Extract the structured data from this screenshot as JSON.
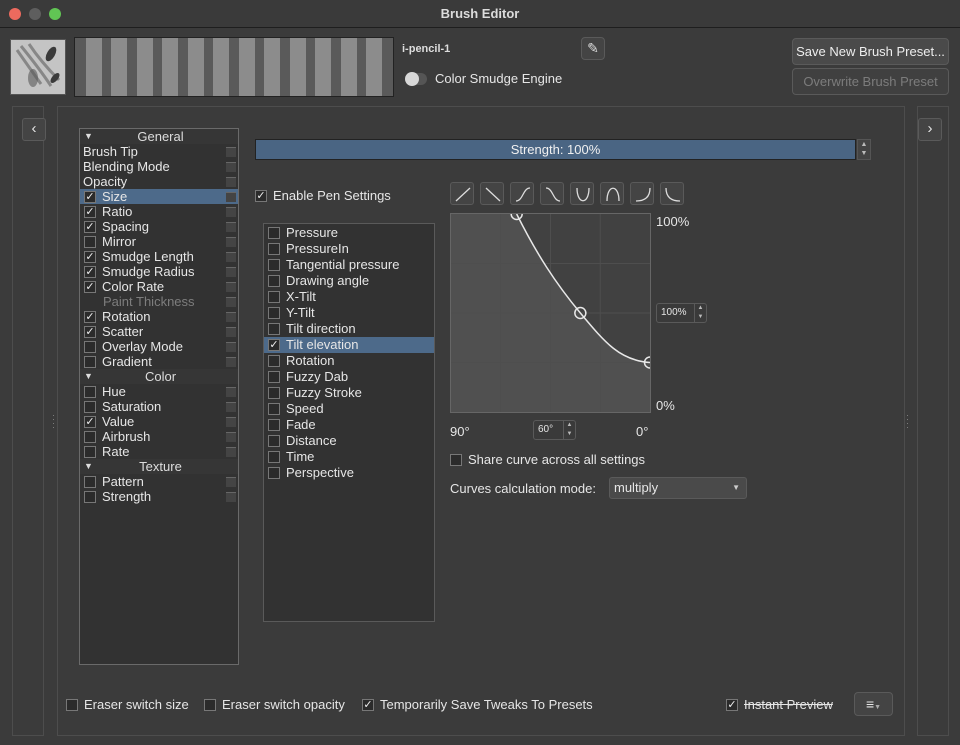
{
  "window": {
    "title": "Brush Editor"
  },
  "header": {
    "preset_name": "i-pencil-1",
    "engine_label": "Color Smudge Engine",
    "save_new_label": "Save New Brush Preset...",
    "overwrite_label": "Overwrite Brush Preset",
    "edit_icon": "pencil-icon"
  },
  "nav": {
    "prev_icon": "chevron-left-icon",
    "next_icon": "chevron-right-icon"
  },
  "options": {
    "general_header": "General",
    "general": [
      {
        "label": "Brush Tip",
        "checkbox": false
      },
      {
        "label": "Blending Mode",
        "checkbox": false
      },
      {
        "label": "Opacity",
        "checkbox": false
      },
      {
        "label": "Size",
        "checkbox": true,
        "checked": true,
        "selected": true
      },
      {
        "label": "Ratio",
        "checkbox": true,
        "checked": true
      },
      {
        "label": "Spacing",
        "checkbox": true,
        "checked": true
      },
      {
        "label": "Mirror",
        "checkbox": true,
        "checked": false
      },
      {
        "label": "Smudge Length",
        "checkbox": true,
        "checked": true
      },
      {
        "label": "Smudge Radius",
        "checkbox": true,
        "checked": true
      },
      {
        "label": "Color Rate",
        "checkbox": true,
        "checked": true
      },
      {
        "label": "Paint Thickness",
        "checkbox": false,
        "disabled": true
      },
      {
        "label": "Rotation",
        "checkbox": true,
        "checked": true
      },
      {
        "label": "Scatter",
        "checkbox": true,
        "checked": true
      },
      {
        "label": "Overlay Mode",
        "checkbox": true,
        "checked": false
      },
      {
        "label": "Gradient",
        "checkbox": true,
        "checked": false
      }
    ],
    "color_header": "Color",
    "color": [
      {
        "label": "Hue",
        "checked": false
      },
      {
        "label": "Saturation",
        "checked": false
      },
      {
        "label": "Value",
        "checked": true
      },
      {
        "label": "Airbrush",
        "checked": false
      },
      {
        "label": "Rate",
        "checked": false
      }
    ],
    "texture_header": "Texture",
    "texture": [
      {
        "label": "Pattern",
        "checked": false
      },
      {
        "label": "Strength",
        "checked": false
      }
    ]
  },
  "strength": {
    "label": "Strength: 100%",
    "value": 1.0
  },
  "pen": {
    "enable_label": "Enable Pen Settings",
    "enabled": true
  },
  "sensors": [
    {
      "label": "Pressure",
      "checked": false
    },
    {
      "label": "PressureIn",
      "checked": false
    },
    {
      "label": "Tangential pressure",
      "checked": false
    },
    {
      "label": "Drawing angle",
      "checked": false
    },
    {
      "label": "X-Tilt",
      "checked": false
    },
    {
      "label": "Y-Tilt",
      "checked": false
    },
    {
      "label": "Tilt direction",
      "checked": false
    },
    {
      "label": "Tilt elevation",
      "checked": true,
      "selected": true
    },
    {
      "label": "Rotation",
      "checked": false
    },
    {
      "label": "Fuzzy Dab",
      "checked": false
    },
    {
      "label": "Fuzzy Stroke",
      "checked": false
    },
    {
      "label": "Speed",
      "checked": false
    },
    {
      "label": "Fade",
      "checked": false
    },
    {
      "label": "Distance",
      "checked": false
    },
    {
      "label": "Time",
      "checked": false
    },
    {
      "label": "Perspective",
      "checked": false
    }
  ],
  "curve": {
    "y_max_label": "100%",
    "y_min_label": "0%",
    "x_left_label": "90°",
    "x_right_label": "0°",
    "y_spin_value": "100%",
    "x_spin_value": "60°",
    "points": [
      [
        0.33,
        1.0
      ],
      [
        0.65,
        0.5
      ],
      [
        1.0,
        0.25
      ]
    ],
    "presets": [
      "linear-icon",
      "inverse-linear-icon",
      "s-curve-icon",
      "inverse-s-curve-icon",
      "u-curve-icon",
      "arch-curve-icon",
      "j-curve-icon",
      "inverse-j-curve-icon"
    ]
  },
  "share_curve_label": "Share curve across all settings",
  "calc_mode": {
    "label": "Curves calculation mode:",
    "value": "multiply"
  },
  "footer": {
    "eraser_size_label": "Eraser switch size",
    "eraser_opacity_label": "Eraser switch opacity",
    "temp_save_label": "Temporarily Save Tweaks To Presets",
    "instant_preview_label": "Instant Preview",
    "menu_icon": "hamburger-menu-icon"
  }
}
